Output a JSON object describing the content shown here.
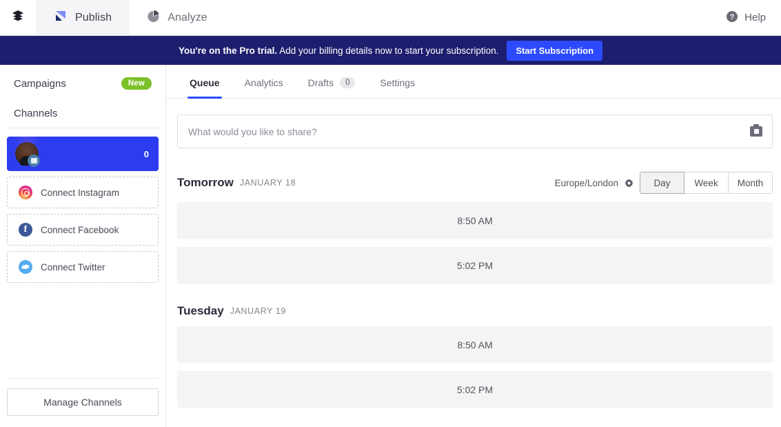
{
  "topnav": {
    "menu_icon": "layers-icon",
    "tabs": [
      {
        "label": "Publish",
        "icon": "publish-logo-icon",
        "active": true
      },
      {
        "label": "Analyze",
        "icon": "pie-chart-icon",
        "active": false
      }
    ],
    "help_label": "Help",
    "help_icon": "question-circle-icon"
  },
  "banner": {
    "bold_text": "You're on the Pro trial.",
    "text": " Add your billing details now to start your subscription.",
    "button_label": "Start Subscription",
    "bg_color": "#1e1e6e",
    "button_color": "#2c4bff"
  },
  "sidebar": {
    "campaigns_label": "Campaigns",
    "campaigns_badge": "New",
    "badge_color": "#7cc128",
    "channels_label": "Channels",
    "channel": {
      "name": "",
      "count": "0",
      "selected_color": "#2c3cf0",
      "avatar_icon": "avatar",
      "network_badge_icon": "network-badge-icon"
    },
    "connect": [
      {
        "label": "Connect Instagram",
        "icon": "instagram-icon"
      },
      {
        "label": "Connect Facebook",
        "icon": "facebook-icon"
      },
      {
        "label": "Connect Twitter",
        "icon": "twitter-icon"
      }
    ],
    "manage_label": "Manage Channels"
  },
  "main": {
    "tabs": [
      {
        "label": "Queue",
        "active": true
      },
      {
        "label": "Analytics",
        "active": false
      },
      {
        "label": "Drafts",
        "count": "0",
        "active": false
      },
      {
        "label": "Settings",
        "active": false
      }
    ],
    "composer_placeholder": "What would you like to share?",
    "composer_camera_icon": "camera-icon",
    "timezone": "Europe/London",
    "timezone_icon": "gear-icon",
    "views": [
      {
        "label": "Day",
        "active": true
      },
      {
        "label": "Week",
        "active": false
      },
      {
        "label": "Month",
        "active": false
      }
    ],
    "days": [
      {
        "name": "Tomorrow",
        "date": "JANUARY 18",
        "slots": [
          "8:50 AM",
          "5:02 PM"
        ]
      },
      {
        "name": "Tuesday",
        "date": "JANUARY 19",
        "slots": [
          "8:50 AM",
          "5:02 PM"
        ]
      }
    ]
  }
}
